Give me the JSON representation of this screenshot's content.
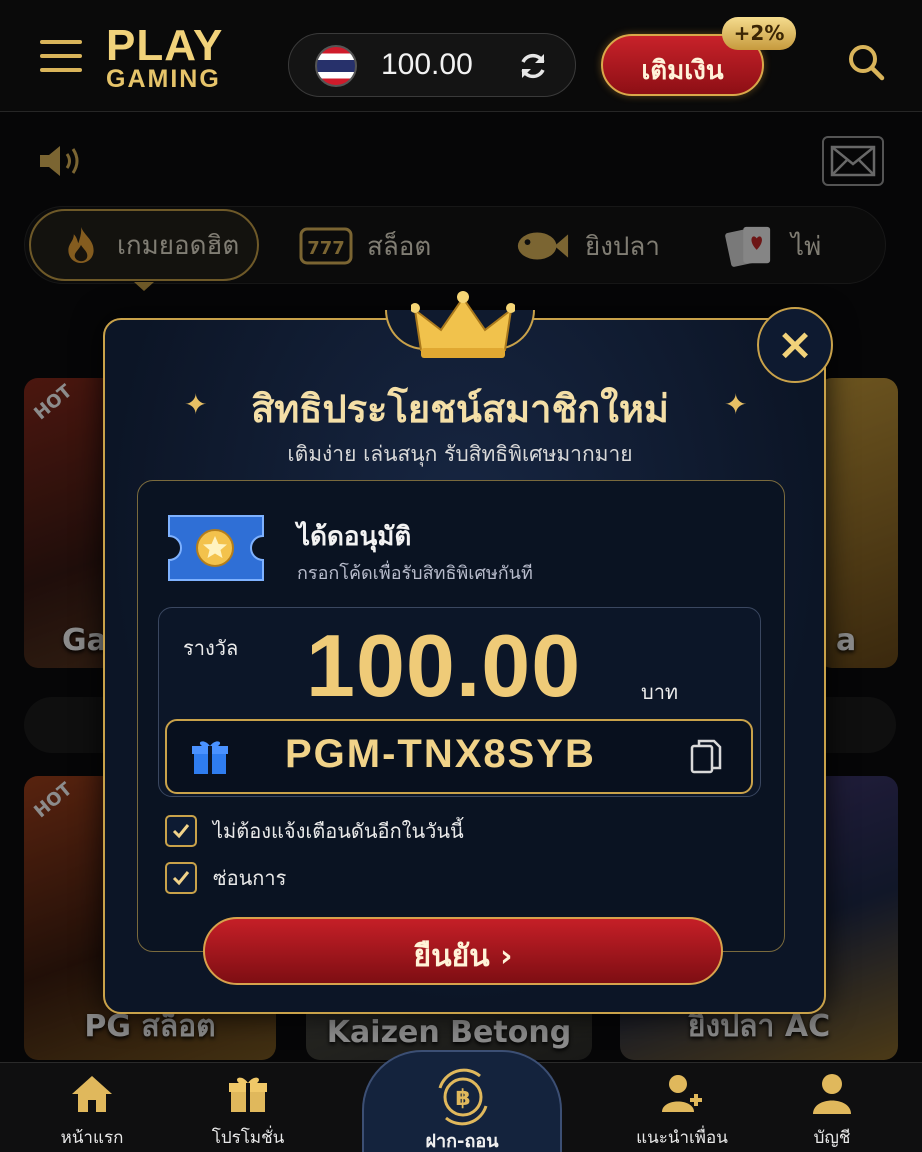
{
  "header": {
    "logo_line1": "PLAY",
    "logo_line2": "GAMING",
    "balance": "100.00",
    "topup_label": "เติมเงิน",
    "topup_bonus": "+2%"
  },
  "tabs": [
    {
      "label": "เกมยอดฮิต",
      "icon": "flame-icon",
      "active": true
    },
    {
      "label": "สล็อต",
      "icon": "slot-777-icon"
    },
    {
      "label": "ยิงปลา",
      "icon": "fish-icon"
    },
    {
      "label": "ไพ่",
      "icon": "cards-icon"
    }
  ],
  "background_cards": {
    "hot_badge": "HOT",
    "card1_partial": "Ga",
    "card2_partial": "a",
    "row2": [
      "PG สล็อต",
      "Kaizen Betong",
      "ยิงปลา AC"
    ]
  },
  "modal": {
    "title": "สิทธิประโยชน์สมาชิกใหม่",
    "subtitle": "เติมง่าย เล่นสนุก รับสิทธิพิเศษมากมาย",
    "approved_title": "ได้ดอนุมัติ",
    "approved_sub": "กรอกโค้ดเพื่อรับสิทธิพิเศษกันที",
    "reward_label": "รางวัล",
    "reward_amount": "100.00",
    "reward_unit": "บาท",
    "code": "PGM-TNX8SYB",
    "check1": "ไม่ต้องแจ้งเตือนดันอีกในวันนี้",
    "check2": "ซ่อนการ",
    "confirm_label": "ยืนยัน ›",
    "close_label": "×"
  },
  "bottom_nav": [
    {
      "label": "หน้าแรก",
      "icon": "home-icon"
    },
    {
      "label": "โปรโมชั่น",
      "icon": "gift-icon"
    },
    {
      "label": "ฝาก-ถอน",
      "icon": "bitcoin-exchange-icon"
    },
    {
      "label": "แนะนำเพื่อน",
      "icon": "add-friend-icon"
    },
    {
      "label": "บัญชี",
      "icon": "account-icon"
    }
  ],
  "colors": {
    "gold": "#c9a24a",
    "red_button": "#c51f27",
    "modal_bg": "#0c1526"
  }
}
